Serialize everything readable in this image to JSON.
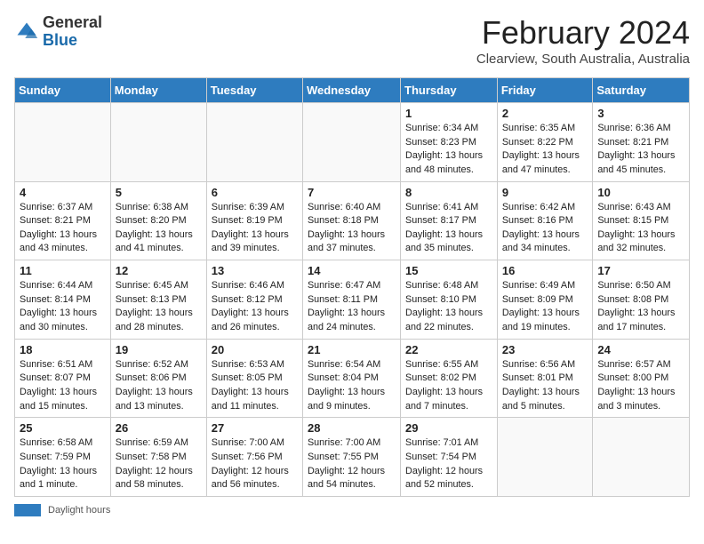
{
  "logo": {
    "general": "General",
    "blue": "Blue"
  },
  "title": "February 2024",
  "subtitle": "Clearview, South Australia, Australia",
  "days_of_week": [
    "Sunday",
    "Monday",
    "Tuesday",
    "Wednesday",
    "Thursday",
    "Friday",
    "Saturday"
  ],
  "weeks": [
    [
      {
        "day": "",
        "info": ""
      },
      {
        "day": "",
        "info": ""
      },
      {
        "day": "",
        "info": ""
      },
      {
        "day": "",
        "info": ""
      },
      {
        "day": "1",
        "info": "Sunrise: 6:34 AM\nSunset: 8:23 PM\nDaylight: 13 hours\nand 48 minutes."
      },
      {
        "day": "2",
        "info": "Sunrise: 6:35 AM\nSunset: 8:22 PM\nDaylight: 13 hours\nand 47 minutes."
      },
      {
        "day": "3",
        "info": "Sunrise: 6:36 AM\nSunset: 8:21 PM\nDaylight: 13 hours\nand 45 minutes."
      }
    ],
    [
      {
        "day": "4",
        "info": "Sunrise: 6:37 AM\nSunset: 8:21 PM\nDaylight: 13 hours\nand 43 minutes."
      },
      {
        "day": "5",
        "info": "Sunrise: 6:38 AM\nSunset: 8:20 PM\nDaylight: 13 hours\nand 41 minutes."
      },
      {
        "day": "6",
        "info": "Sunrise: 6:39 AM\nSunset: 8:19 PM\nDaylight: 13 hours\nand 39 minutes."
      },
      {
        "day": "7",
        "info": "Sunrise: 6:40 AM\nSunset: 8:18 PM\nDaylight: 13 hours\nand 37 minutes."
      },
      {
        "day": "8",
        "info": "Sunrise: 6:41 AM\nSunset: 8:17 PM\nDaylight: 13 hours\nand 35 minutes."
      },
      {
        "day": "9",
        "info": "Sunrise: 6:42 AM\nSunset: 8:16 PM\nDaylight: 13 hours\nand 34 minutes."
      },
      {
        "day": "10",
        "info": "Sunrise: 6:43 AM\nSunset: 8:15 PM\nDaylight: 13 hours\nand 32 minutes."
      }
    ],
    [
      {
        "day": "11",
        "info": "Sunrise: 6:44 AM\nSunset: 8:14 PM\nDaylight: 13 hours\nand 30 minutes."
      },
      {
        "day": "12",
        "info": "Sunrise: 6:45 AM\nSunset: 8:13 PM\nDaylight: 13 hours\nand 28 minutes."
      },
      {
        "day": "13",
        "info": "Sunrise: 6:46 AM\nSunset: 8:12 PM\nDaylight: 13 hours\nand 26 minutes."
      },
      {
        "day": "14",
        "info": "Sunrise: 6:47 AM\nSunset: 8:11 PM\nDaylight: 13 hours\nand 24 minutes."
      },
      {
        "day": "15",
        "info": "Sunrise: 6:48 AM\nSunset: 8:10 PM\nDaylight: 13 hours\nand 22 minutes."
      },
      {
        "day": "16",
        "info": "Sunrise: 6:49 AM\nSunset: 8:09 PM\nDaylight: 13 hours\nand 19 minutes."
      },
      {
        "day": "17",
        "info": "Sunrise: 6:50 AM\nSunset: 8:08 PM\nDaylight: 13 hours\nand 17 minutes."
      }
    ],
    [
      {
        "day": "18",
        "info": "Sunrise: 6:51 AM\nSunset: 8:07 PM\nDaylight: 13 hours\nand 15 minutes."
      },
      {
        "day": "19",
        "info": "Sunrise: 6:52 AM\nSunset: 8:06 PM\nDaylight: 13 hours\nand 13 minutes."
      },
      {
        "day": "20",
        "info": "Sunrise: 6:53 AM\nSunset: 8:05 PM\nDaylight: 13 hours\nand 11 minutes."
      },
      {
        "day": "21",
        "info": "Sunrise: 6:54 AM\nSunset: 8:04 PM\nDaylight: 13 hours\nand 9 minutes."
      },
      {
        "day": "22",
        "info": "Sunrise: 6:55 AM\nSunset: 8:02 PM\nDaylight: 13 hours\nand 7 minutes."
      },
      {
        "day": "23",
        "info": "Sunrise: 6:56 AM\nSunset: 8:01 PM\nDaylight: 13 hours\nand 5 minutes."
      },
      {
        "day": "24",
        "info": "Sunrise: 6:57 AM\nSunset: 8:00 PM\nDaylight: 13 hours\nand 3 minutes."
      }
    ],
    [
      {
        "day": "25",
        "info": "Sunrise: 6:58 AM\nSunset: 7:59 PM\nDaylight: 13 hours\nand 1 minute."
      },
      {
        "day": "26",
        "info": "Sunrise: 6:59 AM\nSunset: 7:58 PM\nDaylight: 12 hours\nand 58 minutes."
      },
      {
        "day": "27",
        "info": "Sunrise: 7:00 AM\nSunset: 7:56 PM\nDaylight: 12 hours\nand 56 minutes."
      },
      {
        "day": "28",
        "info": "Sunrise: 7:00 AM\nSunset: 7:55 PM\nDaylight: 12 hours\nand 54 minutes."
      },
      {
        "day": "29",
        "info": "Sunrise: 7:01 AM\nSunset: 7:54 PM\nDaylight: 12 hours\nand 52 minutes."
      },
      {
        "day": "",
        "info": ""
      },
      {
        "day": "",
        "info": ""
      }
    ]
  ],
  "footer": {
    "daylight_label": "Daylight hours"
  }
}
